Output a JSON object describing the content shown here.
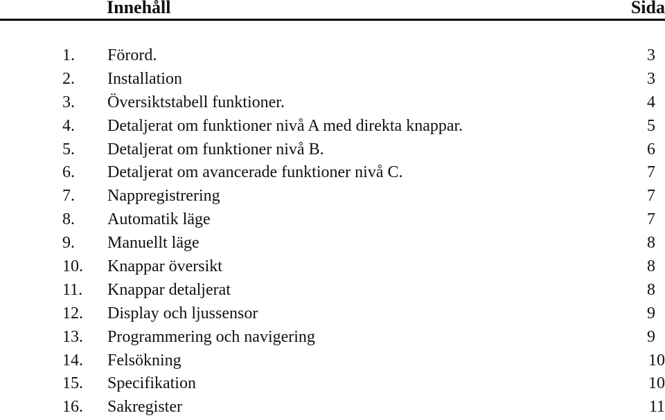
{
  "header": {
    "title": "Innehåll",
    "page_label": "Sida"
  },
  "entries": [
    {
      "num": "1.",
      "title": "Förord.",
      "page": "3"
    },
    {
      "num": "2.",
      "title": "Installation",
      "page": "3"
    },
    {
      "num": "3.",
      "title": "Översiktstabell funktioner.",
      "page": "4"
    },
    {
      "num": "4.",
      "title": "Detaljerat om funktioner nivå A med direkta knappar.",
      "page": "5"
    },
    {
      "num": "5.",
      "title": "Detaljerat om funktioner nivå B.",
      "page": "6"
    },
    {
      "num": "6.",
      "title": "Detaljerat om avancerade funktioner nivå C.",
      "page": "7"
    },
    {
      "num": "7.",
      "title": "Nappregistrering",
      "page": "7"
    },
    {
      "num": "8.",
      "title": "Automatik läge",
      "page": "7"
    },
    {
      "num": "9.",
      "title": "Manuellt läge",
      "page": "8"
    },
    {
      "num": "10.",
      "title": "Knappar översikt",
      "page": "8"
    },
    {
      "num": "11.",
      "title": "Knappar detaljerat",
      "page": "8"
    },
    {
      "num": "12.",
      "title": "Display och ljussensor",
      "page": "9"
    },
    {
      "num": "13.",
      "title": "Programmering och navigering",
      "page": "9"
    },
    {
      "num": "14.",
      "title": "Felsökning",
      "page": "10"
    },
    {
      "num": "15.",
      "title": "Specifikation",
      "page": "10"
    },
    {
      "num": "16.",
      "title": "Sakregister",
      "page": "11"
    }
  ]
}
